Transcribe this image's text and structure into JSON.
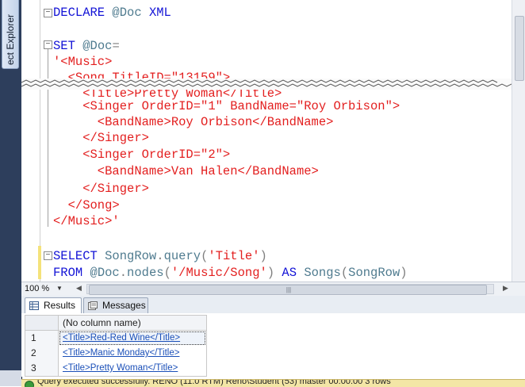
{
  "object_explorer_tab": "ect Explorer",
  "code_lines": [
    [
      {
        "c": "kw",
        "t": "DECLARE "
      },
      {
        "c": "var",
        "t": "@Doc "
      },
      {
        "c": "kw",
        "t": "XML"
      }
    ],
    [],
    [
      {
        "c": "kw",
        "t": "SET "
      },
      {
        "c": "var",
        "t": "@Doc"
      },
      {
        "c": "gray",
        "t": "="
      }
    ],
    [
      {
        "c": "str",
        "t": "'<Music>"
      }
    ],
    [
      {
        "c": "str",
        "t": "  <Song TitleID=\"13159\">"
      }
    ],
    [
      {
        "c": "str",
        "t": "    <Title>Pretty Woman</Title>"
      }
    ],
    [
      {
        "c": "str",
        "t": "    <Singer OrderID=\"1\" BandName=\"Roy Orbison\">"
      }
    ],
    [
      {
        "c": "str",
        "t": "      <BandName>Roy Orbison</BandName>"
      }
    ],
    [
      {
        "c": "str",
        "t": "    </Singer>"
      }
    ],
    [
      {
        "c": "str",
        "t": "    <Singer OrderID=\"2\">"
      }
    ],
    [
      {
        "c": "str",
        "t": "      <BandName>Van Halen</BandName>"
      }
    ],
    [
      {
        "c": "str",
        "t": "    </Singer>"
      }
    ],
    [
      {
        "c": "str",
        "t": "  </Song>"
      }
    ],
    [
      {
        "c": "str",
        "t": "</Music>'"
      }
    ],
    [],
    [
      {
        "c": "kw",
        "t": "SELECT "
      },
      {
        "c": "var",
        "t": "SongRow"
      },
      {
        "c": "gray",
        "t": "."
      },
      {
        "c": "var",
        "t": "query"
      },
      {
        "c": "gray",
        "t": "("
      },
      {
        "c": "str",
        "t": "'Title'"
      },
      {
        "c": "gray",
        "t": ")"
      }
    ],
    [
      {
        "c": "kw",
        "t": "FROM "
      },
      {
        "c": "var",
        "t": "@Doc"
      },
      {
        "c": "gray",
        "t": "."
      },
      {
        "c": "var",
        "t": "nodes"
      },
      {
        "c": "gray",
        "t": "("
      },
      {
        "c": "str",
        "t": "'/Music/Song'"
      },
      {
        "c": "gray",
        "t": ") "
      },
      {
        "c": "kw",
        "t": "AS "
      },
      {
        "c": "var",
        "t": "Songs"
      },
      {
        "c": "gray",
        "t": "("
      },
      {
        "c": "var",
        "t": "SongRow"
      },
      {
        "c": "gray",
        "t": ")"
      }
    ]
  ],
  "zoom": "100 %",
  "tabs": {
    "results": "Results",
    "messages": "Messages"
  },
  "results": {
    "column_header": "(No column name)",
    "rows": [
      {
        "num": "1",
        "value": "<Title>Red-Red Wine</Title>"
      },
      {
        "num": "2",
        "value": "<Title>Manic Monday</Title>"
      },
      {
        "num": "3",
        "value": "<Title>Pretty Woman</Title>"
      }
    ]
  },
  "status_text": "Query executed successfully.   RENO (11.0 RTM)   Reno\\Student (53)   master   00:00:00   3 rows",
  "colors": {
    "keyword": "#1313d6",
    "identifier": "#4f7b8f",
    "string": "#e31f1f",
    "operator": "#7f7f7f",
    "link": "#1a4fb8"
  }
}
